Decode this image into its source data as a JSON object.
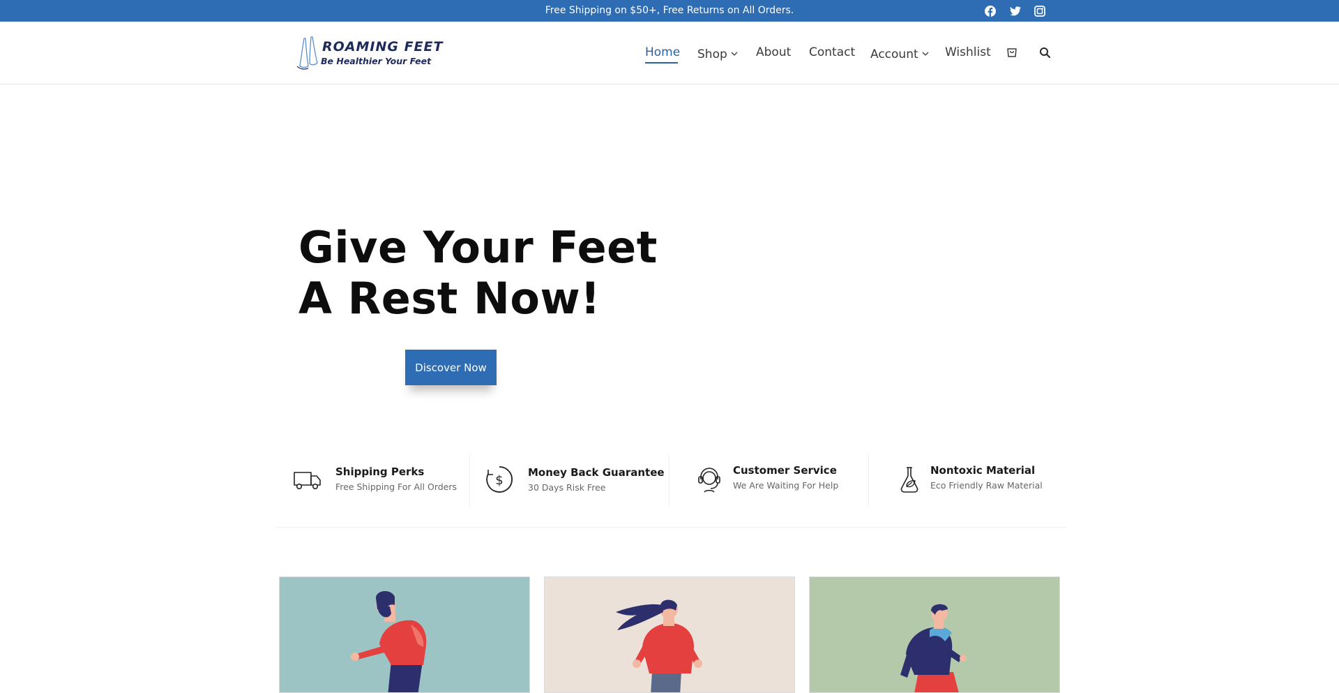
{
  "topbar": {
    "message": "Free Shipping on $50+, Free Returns on All Orders.",
    "socials": [
      "facebook-icon",
      "twitter-icon",
      "instagram-icon"
    ],
    "bg_color": "#2e6db4"
  },
  "header": {
    "logo": {
      "title": "ROAMING FEET",
      "tagline": "Be Healthier Your Feet"
    },
    "nav": [
      {
        "label": "Home",
        "active": true
      },
      {
        "label": "Shop",
        "dropdown": true
      },
      {
        "label": "About"
      },
      {
        "label": "Contact"
      },
      {
        "label": "Account",
        "dropdown": true
      },
      {
        "label": "Wishlist"
      }
    ],
    "icons": [
      "cart-icon",
      "search-icon"
    ],
    "accent_color": "#2b5fa3"
  },
  "hero": {
    "title_line1": "Give Your Feet",
    "title_line2": "A Rest Now!",
    "cta_label": "Discover Now"
  },
  "features": [
    {
      "icon": "truck-icon",
      "title": "Shipping Perks",
      "subtitle": "Free Shipping For All Orders"
    },
    {
      "icon": "money-back-icon",
      "title": "Money Back Guarantee",
      "subtitle": "30 Days Risk Free"
    },
    {
      "icon": "headset-icon",
      "title": "Customer Service",
      "subtitle": "We Are Waiting For Help"
    },
    {
      "icon": "flask-leaf-icon",
      "title": "Nontoxic Material",
      "subtitle": "Eco Friendly Raw Material"
    }
  ],
  "cards": [
    {
      "bg_color": "#9dc4c4",
      "figure": "bearded-man-running"
    },
    {
      "bg_color": "#ebe1d8",
      "figure": "woman-running"
    },
    {
      "bg_color": "#b3c9aa",
      "figure": "man-running"
    }
  ]
}
